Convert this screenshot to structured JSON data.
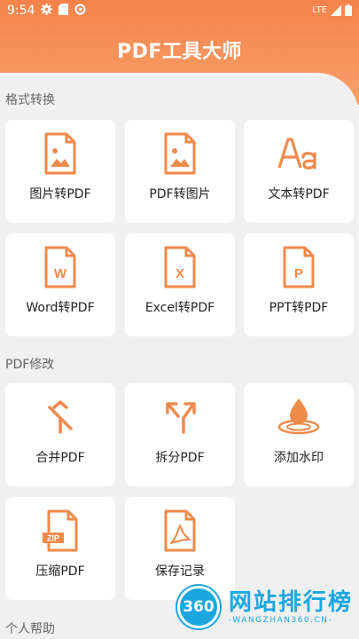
{
  "status_bar": {
    "time": "9:54",
    "network": "LTE"
  },
  "app": {
    "title": "PDF工具大师"
  },
  "sections": [
    {
      "title": "格式转换"
    },
    {
      "title": "PDF修改"
    },
    {
      "title": "个人帮助"
    }
  ],
  "format_conversion": [
    {
      "label": "图片转PDF",
      "icon": "image-file-icon"
    },
    {
      "label": "PDF转图片",
      "icon": "image-file-icon"
    },
    {
      "label": "文本转PDF",
      "icon": "text-aa-icon"
    },
    {
      "label": "Word转PDF",
      "icon": "word-file-icon"
    },
    {
      "label": "Excel转PDF",
      "icon": "excel-file-icon"
    },
    {
      "label": "PPT转PDF",
      "icon": "ppt-file-icon"
    }
  ],
  "pdf_modify": [
    {
      "label": "合并PDF",
      "icon": "merge-icon"
    },
    {
      "label": "拆分PDF",
      "icon": "split-icon"
    },
    {
      "label": "添加水印",
      "icon": "watermark-drop-icon"
    },
    {
      "label": "压缩PDF",
      "icon": "zip-file-icon"
    },
    {
      "label": "保存记录",
      "icon": "pdf-file-icon"
    }
  ],
  "file_glyphs": {
    "word": "W",
    "excel": "X",
    "ppt": "P",
    "zip": "ZIP"
  },
  "watermark": {
    "logo": "360",
    "name": "网站排行榜",
    "url": "WANGZHAN360.CN"
  },
  "colors": {
    "accent": "#f6834a",
    "icon": "#f08a4b",
    "watermark": "#1aa7e0"
  }
}
